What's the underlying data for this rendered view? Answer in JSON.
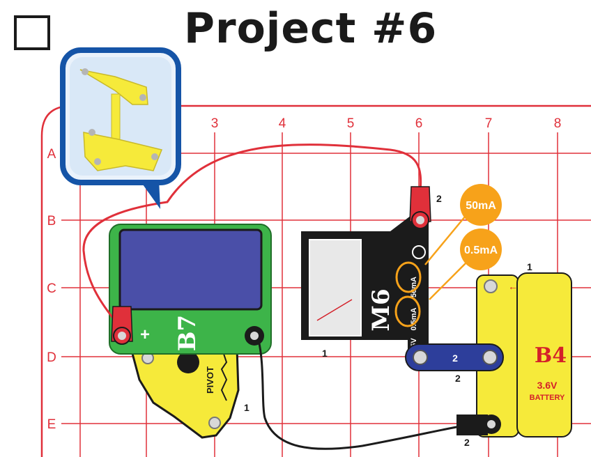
{
  "header": {
    "title": "Project #6"
  },
  "grid": {
    "columns": [
      "3",
      "4",
      "5",
      "6",
      "7",
      "8"
    ],
    "rows": [
      "A",
      "B",
      "C",
      "D",
      "E"
    ]
  },
  "parts": {
    "solar_cell": {
      "label": "B7",
      "plus_sign": "+",
      "stack_level": "1"
    },
    "pivot_stand": {
      "label": "PIVOT",
      "stack_level": "1"
    },
    "meter": {
      "label": "M6",
      "range_high": "50mA",
      "range_low": "0.5mA",
      "range_5v": "5V",
      "stack_level": "1"
    },
    "wire_3snap": {
      "label": "2",
      "stack_level": "2"
    },
    "battery": {
      "label": "B4",
      "voltage": "3.6V",
      "name": "BATTERY",
      "stack_level": "1"
    },
    "red_wire_end_level": "2",
    "black_wire_end_level": "2"
  },
  "callouts": {
    "high": "50mA",
    "low": "0.5mA"
  },
  "colors": {
    "grid": "#e0303a",
    "solar_green": "#3db449",
    "solar_panel": "#4a4fa8",
    "meter_black": "#1b1b1b",
    "battery_yellow": "#f6ea3a",
    "battery_text": "#d42029",
    "wire_blue": "#2d3e9b",
    "callout_orange": "#f7a21a",
    "red_wire": "#e0303a",
    "inset_border": "#1554a7"
  }
}
